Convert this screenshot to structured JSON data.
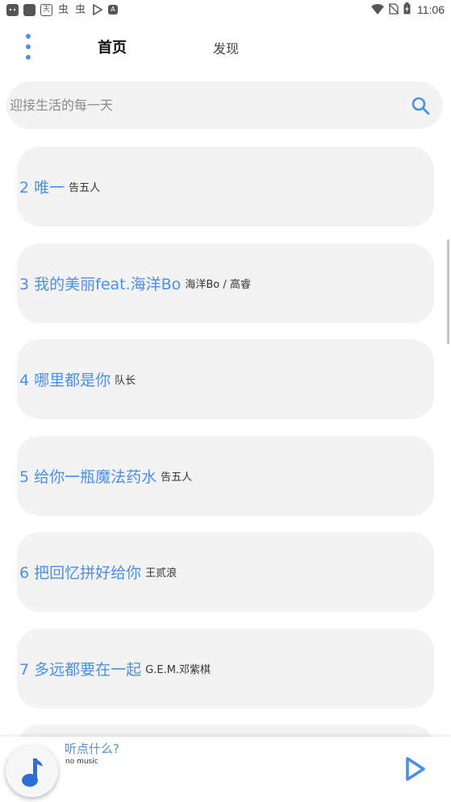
{
  "status_bar": {
    "time": "11:06",
    "left_icons": [
      "game-controller-icon",
      "app-square-icon",
      "calendar-app-icon",
      "bug-icon",
      "bug-icon",
      "play-store-icon",
      "font-a-icon"
    ],
    "calendar_glyph": "天",
    "bug_glyph": "虫",
    "a_glyph": "A"
  },
  "header": {
    "tabs": [
      {
        "label": "首页",
        "active": true
      },
      {
        "label": "发现",
        "active": false
      }
    ]
  },
  "search": {
    "placeholder": "迎接生活的每一天",
    "value": ""
  },
  "songs": [
    {
      "index": "2",
      "title": "唯一",
      "artist": "告五人"
    },
    {
      "index": "3",
      "title": "我的美丽feat.海洋Bo",
      "artist": "海洋Bo / 高睿"
    },
    {
      "index": "4",
      "title": "哪里都是你",
      "artist": "队长"
    },
    {
      "index": "5",
      "title": "给你一瓶魔法药水",
      "artist": "告五人"
    },
    {
      "index": "6",
      "title": "把回忆拼好给你",
      "artist": "王贰浪"
    },
    {
      "index": "7",
      "title": "多远都要在一起",
      "artist": "G.E.M.邓紫棋"
    },
    {
      "index": "",
      "title": "",
      "artist": ""
    }
  ],
  "player": {
    "title": "听点什么?",
    "subtitle": "no music"
  },
  "colors": {
    "accent": "#4a8fe8",
    "card": "#f3f3f3"
  }
}
